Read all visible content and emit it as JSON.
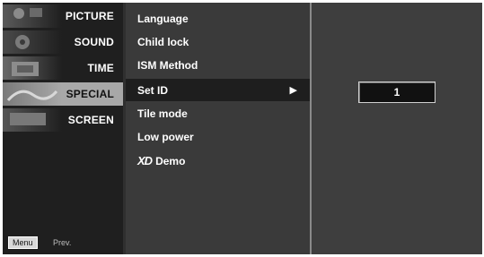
{
  "sidebar": {
    "items": [
      {
        "label": "PICTURE",
        "icon": "picture-thumb-icon"
      },
      {
        "label": "SOUND",
        "icon": "sound-thumb-icon"
      },
      {
        "label": "TIME",
        "icon": "time-thumb-icon"
      },
      {
        "label": "SPECIAL",
        "icon": "special-thumb-icon",
        "active": true
      },
      {
        "label": "SCREEN",
        "icon": "screen-thumb-icon"
      }
    ],
    "menu_badge": "Menu",
    "prev_label": "Prev."
  },
  "submenu": {
    "items": [
      {
        "label": "Language"
      },
      {
        "label": "Child lock"
      },
      {
        "label": "ISM Method"
      },
      {
        "label": "Set ID",
        "active": true,
        "arrow": "▶"
      },
      {
        "label": "Tile mode"
      },
      {
        "label": "Low power"
      },
      {
        "label": "Demo",
        "prefix": "XD"
      }
    ]
  },
  "set_id": {
    "value": "1"
  },
  "colors": {
    "panel": "#2f2f2f",
    "sidebar": "#1f1f1f",
    "active_side": "#a8a8a8",
    "active_row": "#1e1e1e"
  }
}
